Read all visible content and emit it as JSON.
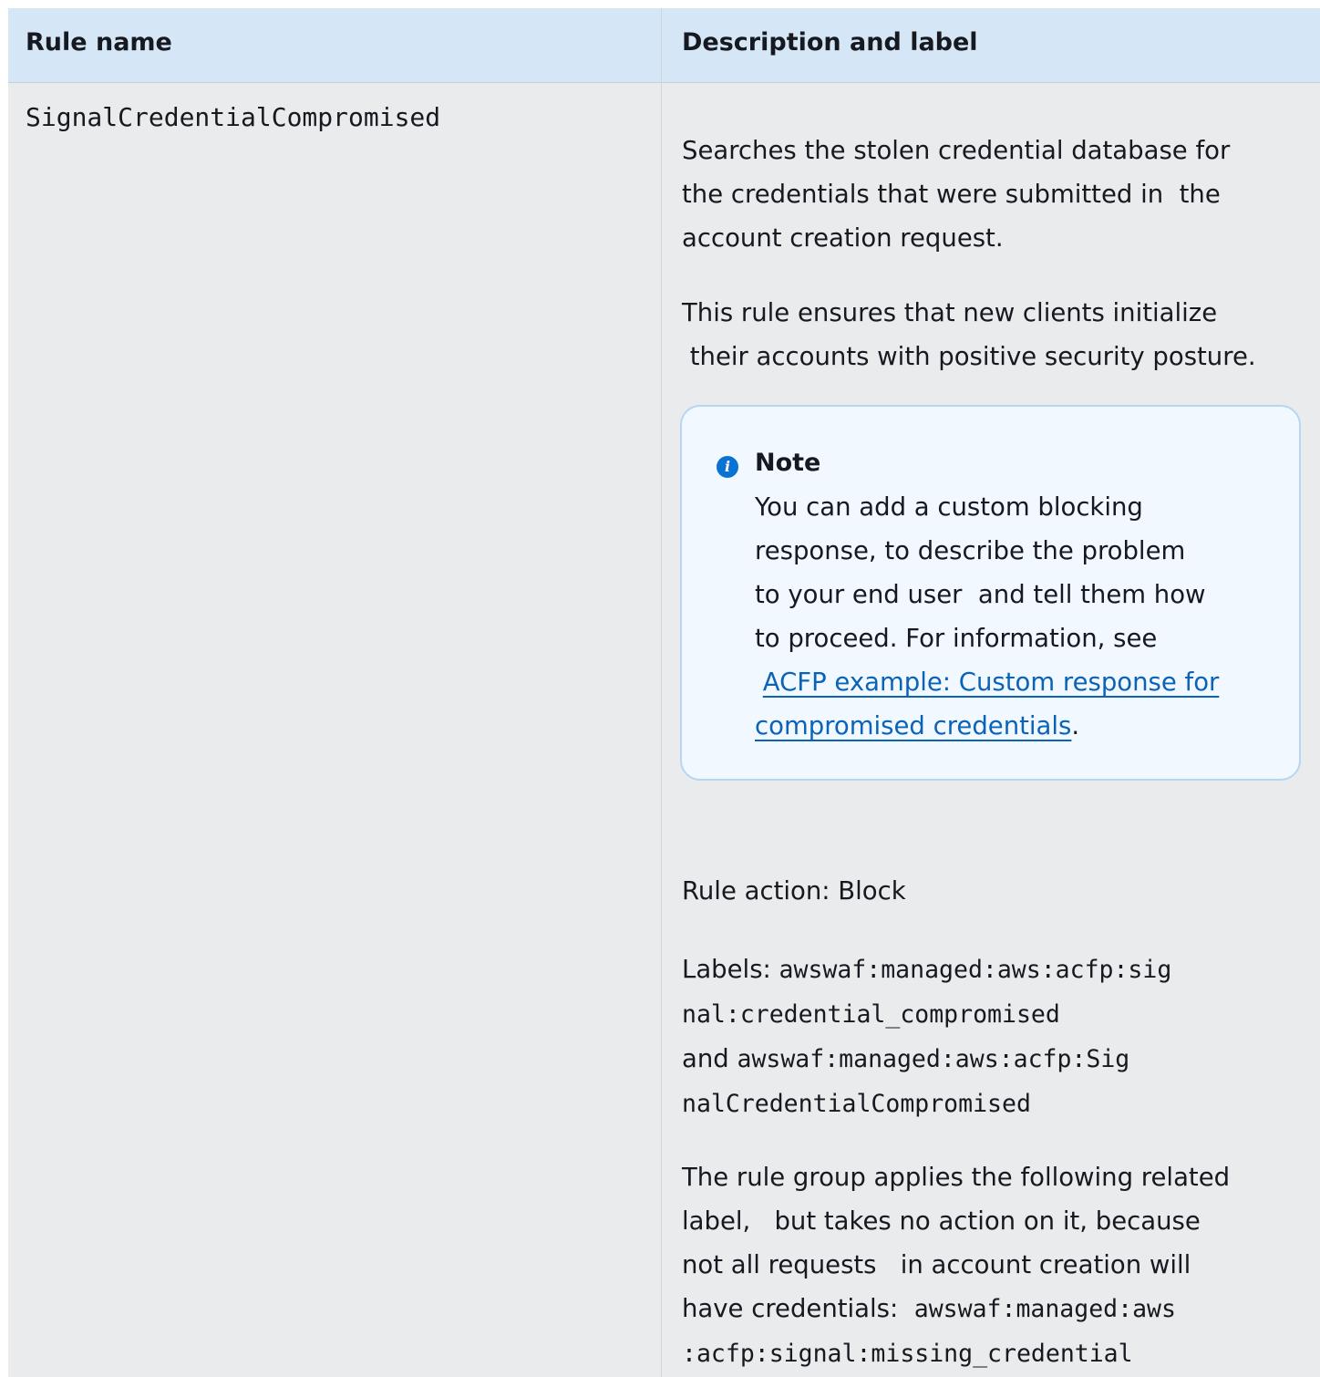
{
  "table": {
    "headers": {
      "rule_name": "Rule name",
      "description": "Description and label"
    },
    "row": {
      "rule_name": "SignalCredentialCompromised",
      "description": {
        "para1": [
          "Searches the stolen credential database for",
          "the credentials that were submitted in  the",
          "account creation request."
        ],
        "para2": [
          "This rule ensures that new clients initialize",
          " their accounts with positive security posture."
        ],
        "note": {
          "icon": "info-icon",
          "title": "Note",
          "lines": [
            "You can add a custom blocking",
            "response, to describe the problem",
            "to your end user  and tell them how",
            "to proceed. For information, see"
          ],
          "link_line1": "ACFP example: Custom response for",
          "link_line2": "compromised credentials",
          "link_after": "."
        },
        "rule_action": "Rule action: Block",
        "labels": {
          "prefix": "Labels: ",
          "label1_part1": "awswaf:managed:aws:acfp:sig",
          "label1_part2": "nal:credential_compromised",
          "conjunction": "and ",
          "label2_part1": "awswaf:managed:aws:acfp:Sig",
          "label2_part2": "nalCredentialCompromised"
        },
        "related": {
          "lines": [
            "The rule group applies the following related",
            "label,   but takes no action on it, because",
            "not all requests   in account creation will"
          ],
          "last_text": "have credentials:  ",
          "label_part1": "awswaf:managed:aws",
          "label_part2": ":acfp:signal:missing_credential"
        }
      }
    }
  },
  "colors": {
    "header_bg": "#d5e6f7",
    "row_bg": "#e9ebed",
    "note_bg": "#f1f8ff",
    "note_border": "#b7d6f2",
    "link": "#0b63b8",
    "info_icon": "#0972d3"
  }
}
